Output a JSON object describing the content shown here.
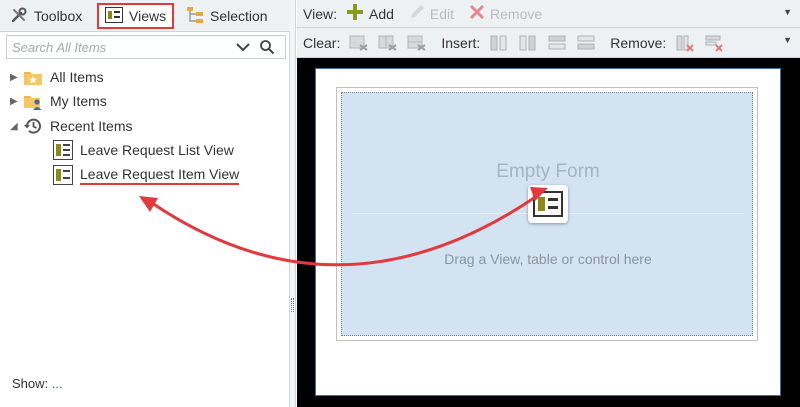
{
  "tabs": [
    {
      "label": "Toolbox",
      "icon": "wrench-screwdriver-icon"
    },
    {
      "label": "Views",
      "icon": "view-icon",
      "highlighted": true
    },
    {
      "label": "Selection",
      "icon": "tree-hierarchy-icon"
    }
  ],
  "search": {
    "placeholder": "Search All Items"
  },
  "tree": {
    "all_items": "All Items",
    "my_items": "My Items",
    "recent_items": "Recent Items",
    "recent_children": [
      "Leave Request List View",
      "Leave Request Item View"
    ]
  },
  "show": {
    "label": "Show:",
    "link": "..."
  },
  "view_toolbar": {
    "label": "View:",
    "add": "Add",
    "edit": "Edit",
    "remove": "Remove"
  },
  "layout_toolbar": {
    "clear_label": "Clear:",
    "insert_label": "Insert:",
    "remove_label": "Remove:"
  },
  "canvas": {
    "title": "Empty Form",
    "hint": "Drag a View, table or control here"
  },
  "colors": {
    "highlight": "#e0393e",
    "accent_olive": "#8a8a1a",
    "link": "#1e6fba",
    "dropzone": "#d3e3f2"
  },
  "annotation": {
    "arrow": "curved-double-arrow",
    "from": "Leave Request Item View",
    "to": "Empty Form"
  }
}
